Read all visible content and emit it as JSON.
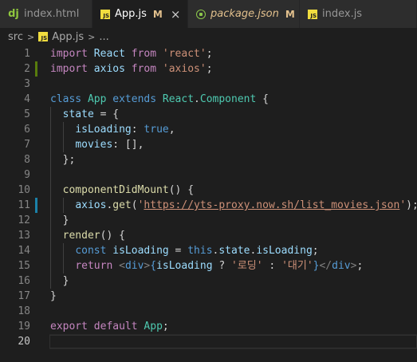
{
  "tabs": [
    {
      "icon": "django-icon",
      "label": "index.html",
      "modified": "",
      "active": false,
      "italic": false
    },
    {
      "icon": "js-icon",
      "label": "App.js",
      "modified": "M",
      "active": true,
      "italic": false
    },
    {
      "icon": "node-package-icon",
      "label": "package.json",
      "modified": "M",
      "active": false,
      "italic": true
    },
    {
      "icon": "js-icon",
      "label": "index.js",
      "modified": "",
      "active": false,
      "italic": false
    }
  ],
  "close_glyph": "×",
  "breadcrumb": {
    "folder": "src",
    "file": "App.js",
    "tail": "..."
  },
  "current_line": 20,
  "colors": {
    "added": "#587c0c",
    "modified": "#1b81a8",
    "keyword": "#569cd6",
    "control": "#c586c0",
    "class": "#4ec9b0",
    "variable": "#9cdcfe",
    "string": "#ce9178",
    "function": "#dcdcaa"
  },
  "lines": [
    {
      "n": "1",
      "change": "",
      "indent": 0,
      "tokens": [
        [
          "kc",
          "import"
        ],
        [
          "pun",
          " "
        ],
        [
          "var",
          "React"
        ],
        [
          "pun",
          " "
        ],
        [
          "kc",
          "from"
        ],
        [
          "pun",
          " "
        ],
        [
          "str",
          "'react'"
        ],
        [
          "pun",
          ";"
        ]
      ]
    },
    {
      "n": "2",
      "change": "add",
      "indent": 0,
      "tokens": [
        [
          "kc",
          "import"
        ],
        [
          "pun",
          " "
        ],
        [
          "var",
          "axios"
        ],
        [
          "pun",
          " "
        ],
        [
          "kc",
          "from"
        ],
        [
          "pun",
          " "
        ],
        [
          "str",
          "'axios'"
        ],
        [
          "pun",
          ";"
        ]
      ]
    },
    {
      "n": "3",
      "change": "",
      "indent": 0,
      "tokens": []
    },
    {
      "n": "4",
      "change": "",
      "indent": 0,
      "tokens": [
        [
          "kw",
          "class"
        ],
        [
          "pun",
          " "
        ],
        [
          "cls",
          "App"
        ],
        [
          "pun",
          " "
        ],
        [
          "kw",
          "extends"
        ],
        [
          "pun",
          " "
        ],
        [
          "cls",
          "React"
        ],
        [
          "pun",
          "."
        ],
        [
          "cls",
          "Component"
        ],
        [
          "pun",
          " {"
        ]
      ]
    },
    {
      "n": "5",
      "change": "",
      "indent": 1,
      "tokens": [
        [
          "pun",
          "  "
        ],
        [
          "var",
          "state"
        ],
        [
          "pun",
          " = {"
        ]
      ]
    },
    {
      "n": "6",
      "change": "",
      "indent": 2,
      "tokens": [
        [
          "pun",
          "    "
        ],
        [
          "var",
          "isLoading"
        ],
        [
          "pun",
          ": "
        ],
        [
          "kw",
          "true"
        ],
        [
          "pun",
          ","
        ]
      ]
    },
    {
      "n": "7",
      "change": "",
      "indent": 2,
      "tokens": [
        [
          "pun",
          "    "
        ],
        [
          "var",
          "movies"
        ],
        [
          "pun",
          ": [],"
        ]
      ]
    },
    {
      "n": "8",
      "change": "",
      "indent": 1,
      "tokens": [
        [
          "pun",
          "  };"
        ]
      ]
    },
    {
      "n": "9",
      "change": "",
      "indent": 1,
      "tokens": []
    },
    {
      "n": "10",
      "change": "",
      "indent": 1,
      "tokens": [
        [
          "pun",
          "  "
        ],
        [
          "fn",
          "componentDidMount"
        ],
        [
          "pun",
          "() {"
        ]
      ]
    },
    {
      "n": "11",
      "change": "mod",
      "indent": 2,
      "tokens": [
        [
          "pun",
          "    "
        ],
        [
          "var",
          "axios"
        ],
        [
          "pun",
          "."
        ],
        [
          "fn",
          "get"
        ],
        [
          "pun",
          "("
        ],
        [
          "str",
          "'"
        ],
        [
          "url",
          "https://yts-proxy.now.sh/list_movies.json"
        ],
        [
          "str",
          "'"
        ],
        [
          "pun",
          ");"
        ]
      ]
    },
    {
      "n": "12",
      "change": "",
      "indent": 1,
      "tokens": [
        [
          "pun",
          "  }"
        ]
      ]
    },
    {
      "n": "13",
      "change": "",
      "indent": 1,
      "tokens": [
        [
          "pun",
          "  "
        ],
        [
          "fn",
          "render"
        ],
        [
          "pun",
          "() {"
        ]
      ]
    },
    {
      "n": "14",
      "change": "",
      "indent": 2,
      "tokens": [
        [
          "pun",
          "    "
        ],
        [
          "kw",
          "const"
        ],
        [
          "pun",
          " "
        ],
        [
          "var",
          "isLoading"
        ],
        [
          "pun",
          " = "
        ],
        [
          "kw",
          "this"
        ],
        [
          "pun",
          "."
        ],
        [
          "var",
          "state"
        ],
        [
          "pun",
          "."
        ],
        [
          "var",
          "isLoading"
        ],
        [
          "pun",
          ";"
        ]
      ]
    },
    {
      "n": "15",
      "change": "",
      "indent": 2,
      "tokens": [
        [
          "pun",
          "    "
        ],
        [
          "kc",
          "return"
        ],
        [
          "pun",
          " "
        ],
        [
          "tag",
          "<"
        ],
        [
          "tagn",
          "div"
        ],
        [
          "tag",
          ">"
        ],
        [
          "kw",
          "{"
        ],
        [
          "var",
          "isLoading"
        ],
        [
          "pun",
          " ? "
        ],
        [
          "str",
          "'로딩'"
        ],
        [
          "pun",
          " : "
        ],
        [
          "str",
          "'대기'"
        ],
        [
          "kw",
          "}"
        ],
        [
          "tag",
          "</"
        ],
        [
          "tagn",
          "div"
        ],
        [
          "tag",
          ">"
        ],
        [
          "pun",
          ";"
        ]
      ]
    },
    {
      "n": "16",
      "change": "",
      "indent": 1,
      "tokens": [
        [
          "pun",
          "  }"
        ]
      ]
    },
    {
      "n": "17",
      "change": "",
      "indent": 0,
      "tokens": [
        [
          "pun",
          "}"
        ]
      ]
    },
    {
      "n": "18",
      "change": "",
      "indent": 0,
      "tokens": []
    },
    {
      "n": "19",
      "change": "",
      "indent": 0,
      "tokens": [
        [
          "kc",
          "export"
        ],
        [
          "pun",
          " "
        ],
        [
          "kc",
          "default"
        ],
        [
          "pun",
          " "
        ],
        [
          "cls",
          "App"
        ],
        [
          "pun",
          ";"
        ]
      ]
    },
    {
      "n": "20",
      "change": "",
      "indent": 0,
      "tokens": []
    }
  ]
}
